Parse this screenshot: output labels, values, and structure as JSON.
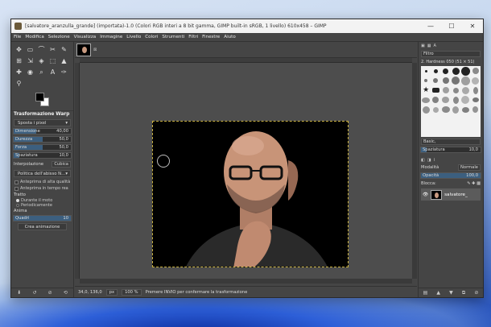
{
  "window": {
    "title": "[salvatore_aranzulla_grande] (importata)-1.0 (Colori RGB interi a 8 bit gamma, GIMP built-in sRGB, 1 livello) 610x458 – GIMP",
    "controls": {
      "minimize": "—",
      "maximize": "☐",
      "close": "✕"
    }
  },
  "menu": [
    "File",
    "Modifica",
    "Selezione",
    "Visualizza",
    "Immagine",
    "Livello",
    "Colori",
    "Strumenti",
    "Filtri",
    "Finestre",
    "Aiuto"
  ],
  "tools": [
    "✥",
    "▭",
    "⌒",
    "✂",
    "✎",
    "⊞",
    "⇲",
    "◈",
    "⬚",
    "▲",
    "✚",
    "◉",
    "⌕",
    "A",
    "✑",
    "⚲"
  ],
  "tool_options": {
    "title": "Trasformazione Warp",
    "mode": "Sposta i pixel",
    "sliders": [
      {
        "label": "Dimensione",
        "value": "40,00",
        "fill": 0.4
      },
      {
        "label": "Durezza",
        "value": "50,0",
        "fill": 0.5
      },
      {
        "label": "Forza",
        "value": "50,0",
        "fill": 0.5
      },
      {
        "label": "Spaziatura",
        "value": "10,0",
        "fill": 0.1
      }
    ],
    "interpolation_label": "Interpolazione",
    "interpolation_value": "Cubica",
    "abyss_policy": "Politica dell'abisso N...",
    "checks": [
      "Anteprima di alta qualità",
      "Anteprima in tempo rea"
    ],
    "stroke_label": "Tratto",
    "stroke_options": [
      "Durante il moto",
      "Periodicamente"
    ],
    "animate_label": "Anima",
    "frames_label": "Quadri",
    "frames_value": "10",
    "create_button": "Crea animazione"
  },
  "status": {
    "coords": "34,0, 136,0",
    "unit": "px",
    "zoom": "100 %",
    "message": "Premere INVIO per confermare la trasformazione"
  },
  "dock": {
    "tabs": [
      "Filtro"
    ],
    "brush_name": "2. Hardness 050 (51 × 51)",
    "brush_set": "Basic,",
    "spacing_label": "Spaziatura",
    "spacing_value": "10,0",
    "mode_label": "Modalità",
    "mode_value": "Normale",
    "opacity_label": "Opacità",
    "opacity_value": "100,0",
    "lock_label": "Blocca:",
    "layer_name": "salvatore_"
  }
}
